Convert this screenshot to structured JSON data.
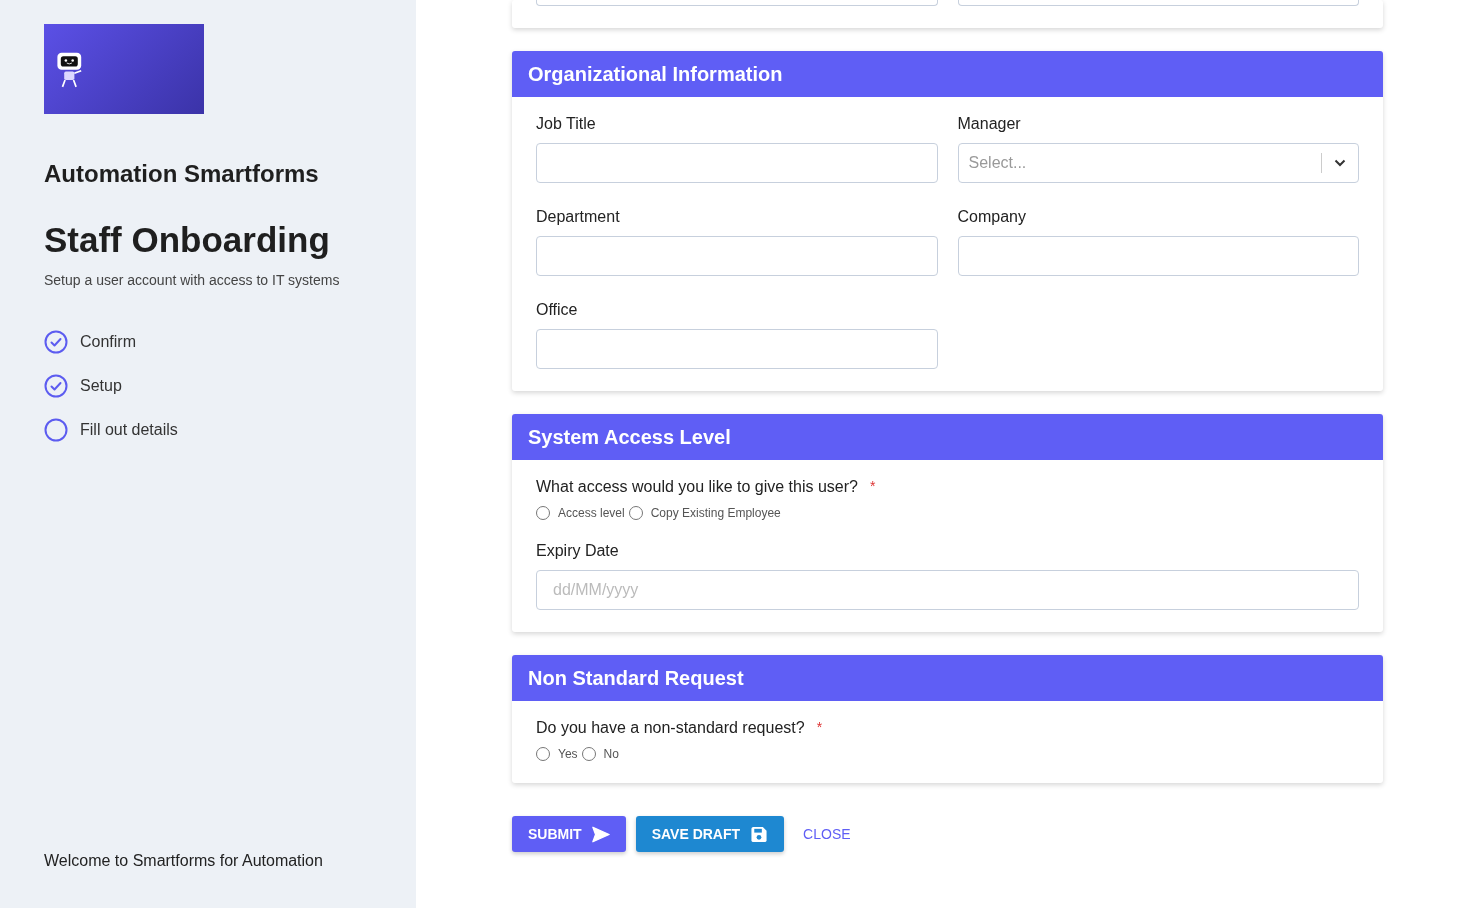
{
  "sidebar": {
    "app_name": "Automation Smartforms",
    "title": "Staff Onboarding",
    "subtitle": "Setup a user account with access to IT systems",
    "steps": [
      {
        "label": "Confirm",
        "done": true
      },
      {
        "label": "Setup",
        "done": true
      },
      {
        "label": "Fill out details",
        "done": false
      }
    ],
    "footer": "Welcome to Smartforms for Automation"
  },
  "sections": [
    {
      "title": "Organizational Information",
      "items": [
        {
          "kind": "text",
          "label": "Job Title"
        },
        {
          "kind": "select",
          "label": "Manager",
          "placeholder": "Select..."
        },
        {
          "kind": "text",
          "label": "Department"
        },
        {
          "kind": "text",
          "label": "Company"
        },
        {
          "kind": "text",
          "label": "Office"
        }
      ]
    },
    {
      "title": "System Access Level",
      "items": [
        {
          "kind": "radio",
          "label": "What access would you like to give this user?",
          "required_mark": "*",
          "options": [
            {
              "label": "Access level",
              "selected": false
            },
            {
              "label": "Copy Existing Employee",
              "selected": false
            }
          ]
        },
        {
          "kind": "date",
          "label": "Expiry Date",
          "placeholder": "dd/MM/yyyy"
        }
      ]
    },
    {
      "title": "Non Standard Request",
      "items": [
        {
          "kind": "radio",
          "label": "Do you have a non-standard request?",
          "required_mark": "*",
          "options": [
            {
              "label": "Yes",
              "selected": false
            },
            {
              "label": "No",
              "selected": false
            }
          ]
        }
      ]
    }
  ],
  "buttons": [
    {
      "kind": "submit",
      "label": "SUBMIT"
    },
    {
      "kind": "draft",
      "label": "SAVE DRAFT"
    },
    {
      "kind": "link",
      "label": "CLOSE"
    }
  ]
}
